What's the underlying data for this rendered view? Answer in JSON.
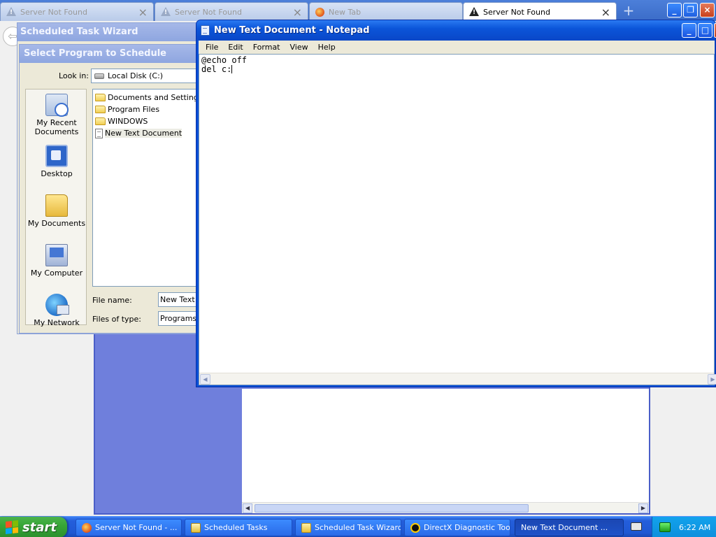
{
  "browser": {
    "tabs": [
      {
        "label": "Server Not Found",
        "icon": "warning-icon"
      },
      {
        "label": "Server Not Found",
        "icon": "warning-icon"
      },
      {
        "label": "New Tab",
        "icon": "firefox-icon"
      },
      {
        "label": "Server Not Found",
        "icon": "warning-icon",
        "active": true
      }
    ],
    "newtab_symbol": "+",
    "back_symbol": "⇦"
  },
  "wizard": {
    "title": "Scheduled Task Wizard",
    "picker": {
      "title": "Select Program to Schedule",
      "lookin_label": "Look in:",
      "lookin_value": "Local Disk (C:)",
      "places": [
        {
          "label": "My Recent Documents",
          "icon": "recent-documents-icon"
        },
        {
          "label": "Desktop",
          "icon": "desktop-icon"
        },
        {
          "label": "My Documents",
          "icon": "my-documents-icon"
        },
        {
          "label": "My Computer",
          "icon": "my-computer-icon"
        },
        {
          "label": "My Network",
          "icon": "my-network-icon"
        }
      ],
      "files": [
        {
          "label": "Documents and Settings",
          "type": "folder"
        },
        {
          "label": "Program Files",
          "type": "folder"
        },
        {
          "label": "WINDOWS",
          "type": "folder"
        },
        {
          "label": "New Text Document",
          "type": "text"
        }
      ],
      "filename_label": "File name:",
      "filename_value": "New Text D",
      "filetype_label": "Files of type:",
      "filetype_value": "Programs"
    }
  },
  "notepad": {
    "title": "New Text Document - Notepad",
    "menu": [
      "File",
      "Edit",
      "Format",
      "View",
      "Help"
    ],
    "content_line1": "@echo off",
    "content_line2": "del c:"
  },
  "taskbar": {
    "start_label": "start",
    "items": [
      {
        "label": "Server Not Found - ...",
        "icon": "firefox-icon"
      },
      {
        "label": "Scheduled Tasks",
        "icon": "scheduled-tasks-icon"
      },
      {
        "label": "Scheduled Task Wizard",
        "icon": "folder-icon"
      },
      {
        "label": "DirectX Diagnostic Tool",
        "icon": "directx-icon"
      },
      {
        "label": "New Text Document ...",
        "icon": "notepad-icon",
        "active": true
      }
    ],
    "clock": "6:22 AM"
  }
}
